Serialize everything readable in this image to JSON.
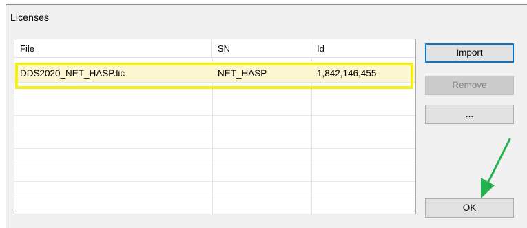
{
  "window": {
    "title": "Licenses"
  },
  "table": {
    "columns": [
      "File",
      "SN",
      "Id"
    ],
    "rows": [
      {
        "file": "DDS2020_NET_HASP.lic",
        "sn": "NET_HASP",
        "id": "1,842,146,455",
        "selected": true
      }
    ]
  },
  "buttons": {
    "import_label": "Import",
    "remove_label": "Remove",
    "more_label": "...",
    "ok_label": "OK"
  },
  "annotations": {
    "highlight_color": "#f2ee1c",
    "arrow_color": "#22b14c",
    "selected_row_color": "#fdf6d3",
    "default_button_border": "#0078d7"
  }
}
